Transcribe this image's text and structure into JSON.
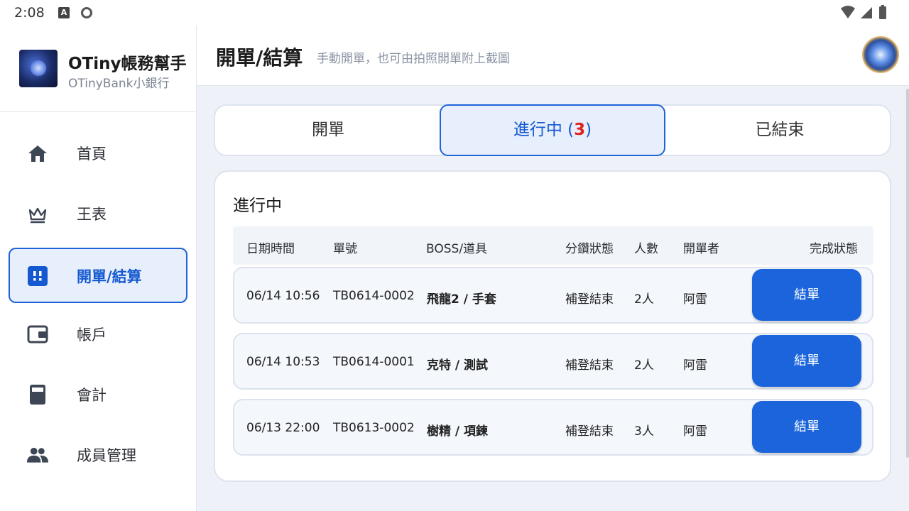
{
  "status_bar": {
    "time": "2:08"
  },
  "sidebar": {
    "app_title": "OTiny帳務幫手",
    "app_subtitle": "OTinyBank小銀行",
    "items": [
      {
        "label": "首頁",
        "icon": "home-icon"
      },
      {
        "label": "王表",
        "icon": "crown-icon"
      },
      {
        "label": "開單/結算",
        "icon": "bill-icon",
        "active": true
      },
      {
        "label": "帳戶",
        "icon": "wallet-icon"
      },
      {
        "label": "會計",
        "icon": "calculator-icon"
      },
      {
        "label": "成員管理",
        "icon": "people-icon"
      }
    ]
  },
  "header": {
    "title": "開單/結算",
    "subtitle": "手動開單，也可由拍照開單附上截圖"
  },
  "tabs": {
    "open": "開單",
    "in_progress": "進行中",
    "in_progress_count": "3",
    "closed": "已結束"
  },
  "card": {
    "title": "進行中",
    "columns": [
      "日期時間",
      "單號",
      "BOSS/道具",
      "分鑽狀態",
      "人數",
      "開單者",
      "完成狀態"
    ],
    "rows": [
      {
        "datetime": "06/14 10:56",
        "order_no": "TB0614-0002",
        "boss_item": "飛龍2 / 手套",
        "split_status": "補登結束",
        "people": "2人",
        "creator": "阿雷",
        "action": "結單"
      },
      {
        "datetime": "06/14 10:53",
        "order_no": "TB0614-0001",
        "boss_item": "克特 / 測試",
        "split_status": "補登結束",
        "people": "2人",
        "creator": "阿雷",
        "action": "結單"
      },
      {
        "datetime": "06/13 22:00",
        "order_no": "TB0613-0002",
        "boss_item": "樹精 / 項鍊",
        "split_status": "補登結束",
        "people": "3人",
        "creator": "阿雷",
        "action": "結單"
      }
    ]
  },
  "colors": {
    "accent": "#1b64db",
    "active_bg": "#e8effc",
    "count_red": "#e0221a",
    "main_bg": "#eef2f8"
  }
}
